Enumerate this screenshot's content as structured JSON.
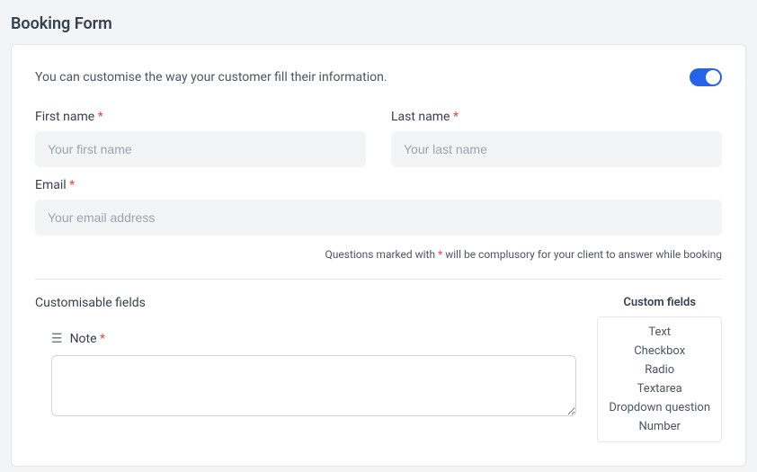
{
  "page": {
    "title": "Booking Form"
  },
  "intro": {
    "text": "You can customise the way your customer fill their information."
  },
  "fields": {
    "first_name": {
      "label": "First name",
      "req": "*",
      "placeholder": "Your first name"
    },
    "last_name": {
      "label": "Last name",
      "req": "*",
      "placeholder": "Your last name"
    },
    "email": {
      "label": "Email",
      "req": "*",
      "placeholder": "Your email address"
    }
  },
  "hint": {
    "prefix": "Questions marked with ",
    "asterisk": "*",
    "suffix": " will be complusory for your client to answer while booking"
  },
  "custom": {
    "title": "Customisable fields",
    "note_label": "Note",
    "note_req": "*",
    "palette_title": "Custom fields",
    "palette": {
      "0": "Text",
      "1": "Checkbox",
      "2": "Radio",
      "3": "Textarea",
      "4": "Dropdown question",
      "5": "Number"
    }
  }
}
